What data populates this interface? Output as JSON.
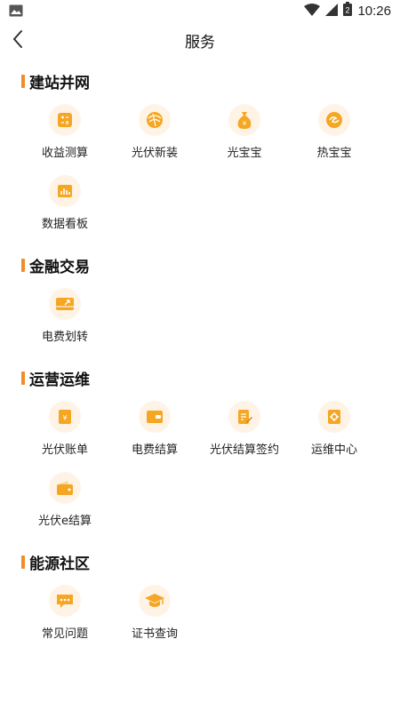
{
  "status_bar": {
    "time": "10:26",
    "battery_level": "2"
  },
  "nav": {
    "title": "服务"
  },
  "sections": [
    {
      "title": "建站并网",
      "items": [
        {
          "label": "收益测算",
          "icon": "calculator-icon"
        },
        {
          "label": "光伏新装",
          "icon": "solar-install-icon"
        },
        {
          "label": "光宝宝",
          "icon": "money-bag-icon"
        },
        {
          "label": "热宝宝",
          "icon": "heat-icon"
        },
        {
          "label": "数据看板",
          "icon": "chart-board-icon"
        }
      ]
    },
    {
      "title": "金融交易",
      "items": [
        {
          "label": "电费划转",
          "icon": "card-transfer-icon"
        }
      ]
    },
    {
      "title": "运营运维",
      "items": [
        {
          "label": "光伏账单",
          "icon": "bill-icon"
        },
        {
          "label": "电费结算",
          "icon": "wallet-card-icon"
        },
        {
          "label": "光伏结算签约",
          "icon": "document-sign-icon"
        },
        {
          "label": "运维中心",
          "icon": "gear-book-icon"
        },
        {
          "label": "光伏e结算",
          "icon": "wallet-icon"
        }
      ]
    },
    {
      "title": "能源社区",
      "items": [
        {
          "label": "常见问题",
          "icon": "chat-icon"
        },
        {
          "label": "证书查询",
          "icon": "graduation-cap-icon"
        }
      ]
    }
  ],
  "colors": {
    "accent": "#f28c28",
    "icon_bg": "#fff3e6"
  }
}
